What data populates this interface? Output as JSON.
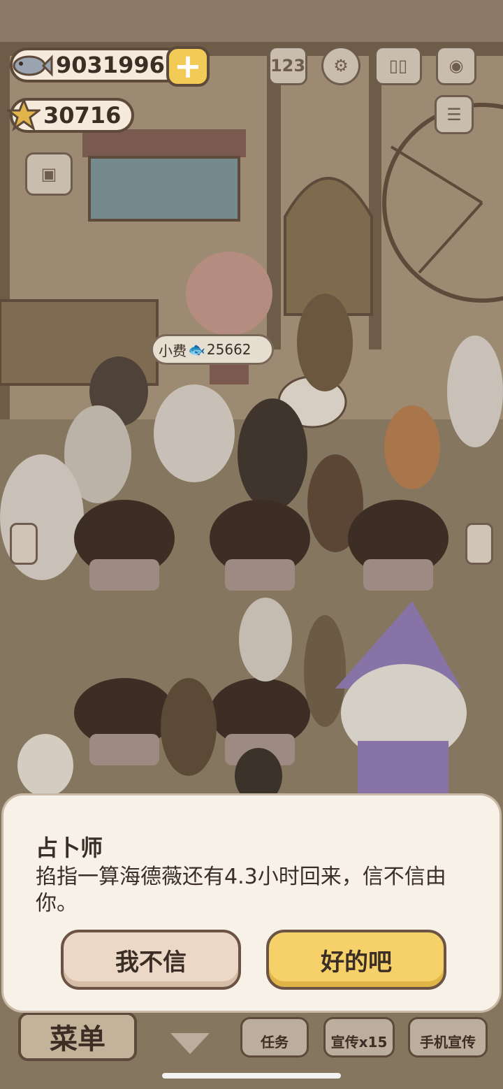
{
  "hud": {
    "fish_count": "9031996",
    "star_count": "30716"
  },
  "tip_bubble": {
    "label": "小费",
    "amount": "25662"
  },
  "dialog": {
    "title": "占卜师",
    "message": "掐指一算海德薇还有4.3小时回来，信不信由你。",
    "cancel_label": "我不信",
    "confirm_label": "好的吧"
  },
  "bottom_bar": {
    "menu_label": "菜单",
    "task_label": "任务",
    "promote_label": "宣传x15",
    "phone_promote_label": "手机宣传"
  },
  "colors": {
    "dialog_bg": "#f8f1e8",
    "confirm_button": "#f6d16a",
    "cancel_button": "#ecd8c6",
    "dim_overlay": "#8a7b66"
  }
}
